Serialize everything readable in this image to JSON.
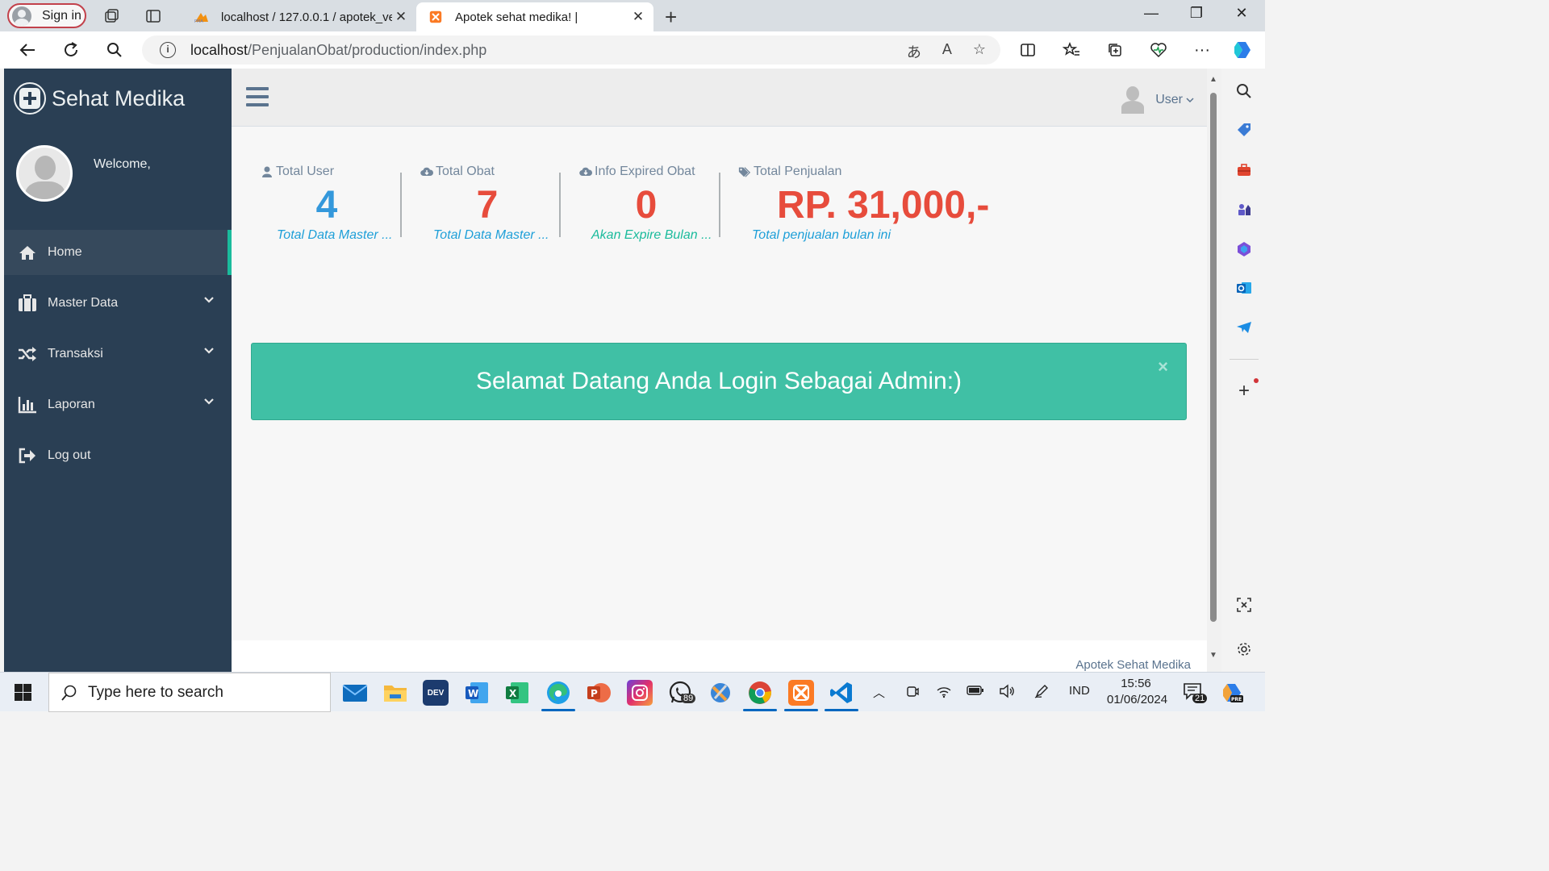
{
  "browser": {
    "signin_label": "Sign in",
    "tabs": [
      {
        "title": "localhost / 127.0.0.1 / apotek_ver",
        "active": false
      },
      {
        "title": "Apotek sehat medika! |",
        "active": true
      }
    ],
    "url_host": "localhost",
    "url_path": "/PenjualanObat/production/index.php"
  },
  "app": {
    "brand": "Sehat Medika",
    "welcome": "Welcome,",
    "menu": [
      {
        "label": "Home",
        "icon": "home-icon",
        "active": true
      },
      {
        "label": "Master Data",
        "icon": "briefcase-icon",
        "active": false
      },
      {
        "label": "Transaksi",
        "icon": "shuffle-icon",
        "active": false
      },
      {
        "label": "Laporan",
        "icon": "bar-chart-icon",
        "active": false
      },
      {
        "label": "Log out",
        "icon": "sign-out-icon",
        "active": false
      }
    ],
    "user_label": "User"
  },
  "tiles": [
    {
      "title": "Total User",
      "value": "4",
      "sub": "Total Data Master ...",
      "icon": "user-icon",
      "value_color": "#3498db"
    },
    {
      "title": "Total Obat",
      "value": "7",
      "sub": "Total Data Master ...",
      "icon": "cloud-download-icon",
      "value_color": "#e74c3c"
    },
    {
      "title": "Info Expired Obat",
      "value": "0",
      "sub": "Akan Expire Bulan ...",
      "icon": "cloud-download-icon",
      "value_color": "#e74c3c"
    },
    {
      "title": "Total Penjualan",
      "value": "RP. 31,000,-",
      "sub": "Total penjualan bulan ini",
      "icon": "tags-icon",
      "value_color": "#e74c3c"
    }
  ],
  "alert": {
    "message": "Selamat Datang Anda Login Sebagai Admin:)",
    "close": "×",
    "color": "#40c0a5"
  },
  "footer": {
    "text": "Apotek Sehat Medika"
  },
  "taskbar": {
    "search_placeholder": "Type here to search",
    "whatsapp_badge": "89",
    "lang": "IND",
    "time": "15:56",
    "date": "01/06/2024",
    "notifications": "21"
  },
  "colors": {
    "sidebar": "#2a3f54",
    "accent": "#1abb9c",
    "blue": "#3498db",
    "red": "#e74c3c"
  }
}
